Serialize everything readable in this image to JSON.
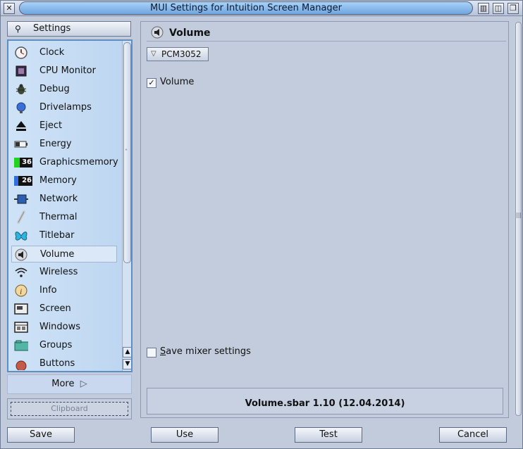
{
  "window": {
    "title": "MUI Settings for Intuition Screen Manager"
  },
  "sidebar": {
    "header_label": "Settings",
    "items": [
      {
        "label": "Clock",
        "icon": "clock-icon"
      },
      {
        "label": "CPU Monitor",
        "icon": "cpu-icon"
      },
      {
        "label": "Debug",
        "icon": "bug-icon"
      },
      {
        "label": "Drivelamps",
        "icon": "lamp-icon"
      },
      {
        "label": "Eject",
        "icon": "eject-icon"
      },
      {
        "label": "Energy",
        "icon": "battery-icon"
      },
      {
        "label": "Graphicsmemory",
        "icon": "graphics-memory-icon",
        "badge": "36"
      },
      {
        "label": "Memory",
        "icon": "memory-icon",
        "badge": "26"
      },
      {
        "label": "Network",
        "icon": "network-icon"
      },
      {
        "label": "Thermal",
        "icon": "thermometer-icon"
      },
      {
        "label": "Titlebar",
        "icon": "butterfly-icon"
      },
      {
        "label": "Volume",
        "icon": "speaker-icon"
      },
      {
        "label": "Wireless",
        "icon": "wifi-icon"
      },
      {
        "label": "Info",
        "icon": "info-icon"
      },
      {
        "label": "Screen",
        "icon": "screen-icon"
      },
      {
        "label": "Windows",
        "icon": "windows-icon"
      },
      {
        "label": "Groups",
        "icon": "folder-icon"
      },
      {
        "label": "Buttons",
        "icon": "button-icon"
      }
    ],
    "selected": "Volume",
    "more_label": "More",
    "clipboard_label": "Clipboard"
  },
  "panel": {
    "title": "Volume",
    "device": "PCM3052",
    "volume_checkbox": {
      "label": "Volume",
      "checked": true
    },
    "save_mixer": {
      "label_first": "S",
      "label_rest": "ave mixer settings",
      "checked": false
    },
    "about_title": "Volume.sbar 1.10 (12.04.2014)"
  },
  "buttons": {
    "save": "Save",
    "use": "Use",
    "test": "Test",
    "cancel": "Cancel"
  },
  "colors": {
    "selection_bg": "#dbe8f7",
    "list_border": "#5f8dc5",
    "title_pill": "#6fa5df"
  }
}
